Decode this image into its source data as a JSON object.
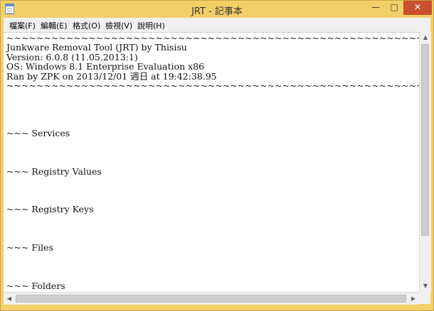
{
  "window": {
    "title": "JRT - 記事本",
    "controls": {
      "minimize": "—",
      "maximize": "□",
      "close": "✕"
    }
  },
  "menu": [
    {
      "label": "檔案(F)"
    },
    {
      "label": "編輯(E)"
    },
    {
      "label": "格式(O)"
    },
    {
      "label": "檢視(V)"
    },
    {
      "label": "說明(H)"
    }
  ],
  "document": {
    "text": "~~~~~~~~~~~~~~~~~~~~~~~~~~~~~~~~~~~~~~~~~~~~~~~~~~~~~~~~~~~~~~~\nJunkware Removal Tool (JRT) by Thisisu\nVersion: 6.0.8 (11.05.2013:1)\nOS: Windows 8.1 Enterprise Evaluation x86\nRan by ZPK on 2013/12/01 週日 at 19:42:38.95\n~~~~~~~~~~~~~~~~~~~~~~~~~~~~~~~~~~~~~~~~~~~~~~~~~~~~~~~~~~~~~~~\n\n\n\n\n~~~ Services\n\n\n\n~~~ Registry Values\n\n\n\n~~~ Registry Keys\n\n\n\n~~~ Files\n\n\n\n~~~ Folders"
  },
  "scrollbars": {
    "vertical": {
      "up_arrow": "▲",
      "down_arrow": "▼",
      "position": 0.0
    },
    "horizontal": {
      "left_arrow": "◀",
      "right_arrow": "▶",
      "position": 0.0
    }
  }
}
